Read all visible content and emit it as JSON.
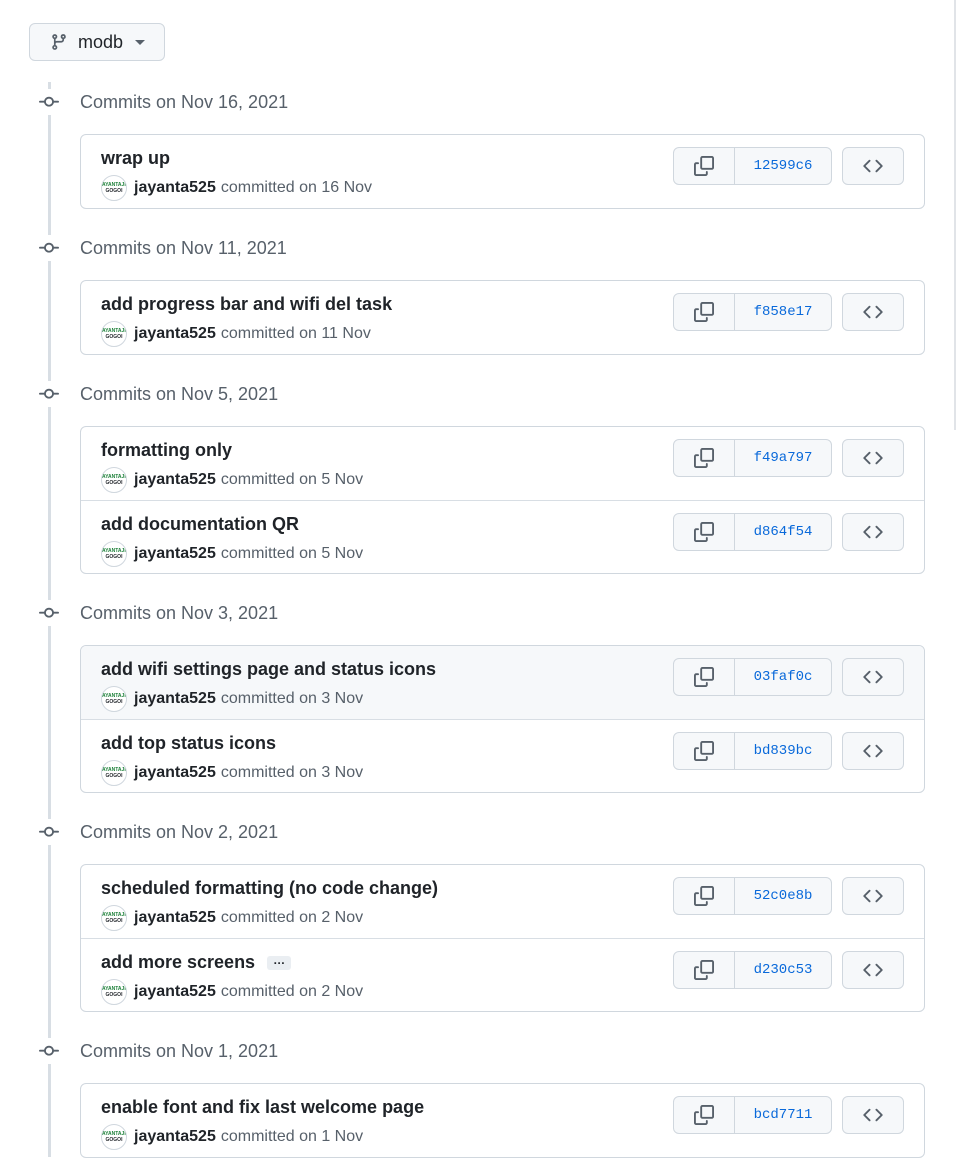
{
  "branch": {
    "name": "modb"
  },
  "groups": [
    {
      "date": "Commits on Nov 16, 2021",
      "commits": [
        {
          "message": "wrap up",
          "author": "jayanta525",
          "committed": "committed on 16 Nov",
          "sha": "12599c6",
          "highlighted": false,
          "has_ellipsis": false
        }
      ]
    },
    {
      "date": "Commits on Nov 11, 2021",
      "commits": [
        {
          "message": "add progress bar and wifi del task",
          "author": "jayanta525",
          "committed": "committed on 11 Nov",
          "sha": "f858e17",
          "highlighted": false,
          "has_ellipsis": false
        }
      ]
    },
    {
      "date": "Commits on Nov 5, 2021",
      "commits": [
        {
          "message": "formatting only",
          "author": "jayanta525",
          "committed": "committed on 5 Nov",
          "sha": "f49a797",
          "highlighted": false,
          "has_ellipsis": false
        },
        {
          "message": "add documentation QR",
          "author": "jayanta525",
          "committed": "committed on 5 Nov",
          "sha": "d864f54",
          "highlighted": false,
          "has_ellipsis": false
        }
      ]
    },
    {
      "date": "Commits on Nov 3, 2021",
      "commits": [
        {
          "message": "add wifi settings page and status icons",
          "author": "jayanta525",
          "committed": "committed on 3 Nov",
          "sha": "03faf0c",
          "highlighted": true,
          "has_ellipsis": false
        },
        {
          "message": "add top status icons",
          "author": "jayanta525",
          "committed": "committed on 3 Nov",
          "sha": "bd839bc",
          "highlighted": false,
          "has_ellipsis": false
        }
      ]
    },
    {
      "date": "Commits on Nov 2, 2021",
      "commits": [
        {
          "message": "scheduled formatting (no code change)",
          "author": "jayanta525",
          "committed": "committed on 2 Nov",
          "sha": "52c0e8b",
          "highlighted": false,
          "has_ellipsis": false
        },
        {
          "message": "add more screens",
          "author": "jayanta525",
          "committed": "committed on 2 Nov",
          "sha": "d230c53",
          "highlighted": false,
          "has_ellipsis": true,
          "ellipsis_label": "…"
        }
      ]
    },
    {
      "date": "Commits on Nov 1, 2021",
      "commits": [
        {
          "message": "enable font and fix last welcome page",
          "author": "jayanta525",
          "committed": "committed on 1 Nov",
          "sha": "bcd7711",
          "highlighted": false,
          "has_ellipsis": false
        }
      ]
    }
  ],
  "avatar_text": [
    "JAYANTAJIT",
    "GOGOI"
  ],
  "colors": {
    "link": "#0969da",
    "muted": "#57606a",
    "border": "#d0d7de",
    "highlight_bg": "#f6f8fa"
  }
}
